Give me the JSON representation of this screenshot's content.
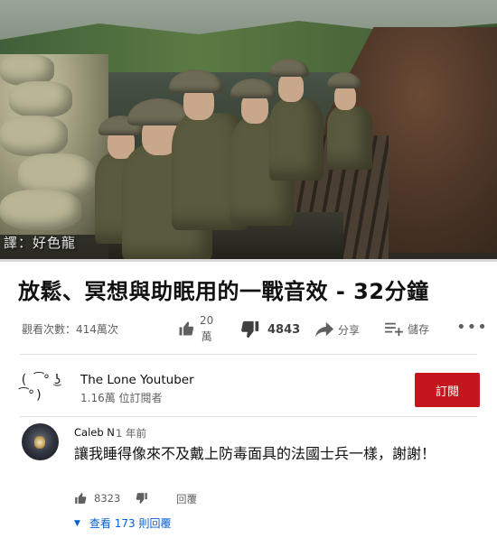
{
  "video": {
    "translator_watermark": "譯：好色龍",
    "title": "放鬆、冥想與助眠用的一戰音效 - 32分鐘"
  },
  "stats": {
    "views": "觀看次數：414萬次"
  },
  "actions": {
    "like_count_line1": "20",
    "like_count_line2": "萬",
    "dislike_count": "4843",
    "share_label": "分享",
    "save_label": "儲存",
    "more": "•••"
  },
  "channel": {
    "avatar_text": "( ͡° ͜ʖ ͡°)",
    "name": "The Lone Youtuber",
    "subscribers": "1.16萬 位訂閱者",
    "subscribe_label": "訂閱"
  },
  "comment": {
    "author": "Caleb N",
    "time": "1 年前",
    "text": "讓我睡得像來不及戴上防毒面具的法國士兵一樣，謝謝！",
    "like_count": "8323",
    "reply_label": "回覆",
    "view_replies": "查看 173 則回覆"
  },
  "colors": {
    "subscribe_bg": "#c4161c",
    "link_blue": "#065fd4",
    "secondary_text": "#606060"
  }
}
